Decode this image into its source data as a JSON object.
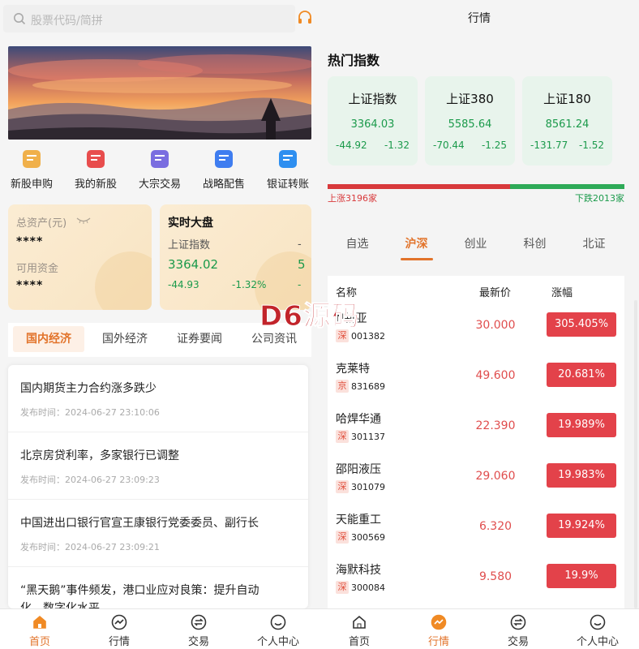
{
  "left": {
    "search": {
      "placeholder": "股票代码/简拼"
    },
    "quick": [
      {
        "label": "新股申购",
        "icon": "ipo-icon",
        "color": "#f0b04a"
      },
      {
        "label": "我的新股",
        "icon": "my-stock-icon",
        "color": "#e84d4d"
      },
      {
        "label": "大宗交易",
        "icon": "block-trade-icon",
        "color": "#7a6de0"
      },
      {
        "label": "战略配售",
        "icon": "placement-icon",
        "color": "#3f7df0"
      },
      {
        "label": "银证转账",
        "icon": "bank-transfer-icon",
        "color": "#2e8ff0"
      }
    ],
    "assets": {
      "total_label": "总资产(元)",
      "total_value": "****",
      "avail_label": "可用资金",
      "avail_value": "****"
    },
    "bigboard": {
      "title": "实时大盘",
      "name": "上证指数",
      "price": "3364.02",
      "chg": "-44.93",
      "pct": "-1.32%",
      "ghost_name": "-",
      "ghost_price": "5",
      "ghost_chg": "-"
    },
    "news_tabs": [
      "国内经济",
      "国外经济",
      "证券要闻",
      "公司资讯"
    ],
    "news": [
      {
        "title": "国内期货主力合约涨多跌少",
        "time": "发布时间：2024-06-27 23:10:06"
      },
      {
        "title": "北京房贷利率，多家银行已调整",
        "time": "发布时间：2024-06-27 23:09:23"
      },
      {
        "title": "中国进出口银行官宣王康银行党委委员、副行长",
        "time": "发布时间：2024-06-27 23:09:21"
      },
      {
        "title": "“黑天鹅”事件频发，港口业应对良策：提升自动",
        "time": "化、数字化水平"
      }
    ]
  },
  "right": {
    "title": "行情",
    "hot_title": "热门指数",
    "indices": [
      {
        "name": "上证指数",
        "price": "3364.03",
        "chg": "-44.92",
        "pct": "-1.32"
      },
      {
        "name": "上证380",
        "price": "5585.64",
        "chg": "-70.44",
        "pct": "-1.25"
      },
      {
        "name": "上证180",
        "price": "8561.24",
        "chg": "-131.77",
        "pct": "-1.52"
      }
    ],
    "up_label": "上涨3196家",
    "down_label": "下跌2013家",
    "up_ratio": 0.615,
    "market_tabs": [
      "自选",
      "沪深",
      "创业",
      "科创",
      "北证"
    ],
    "table_headers": {
      "name": "名称",
      "price": "最新价",
      "change": "涨幅"
    },
    "stocks": [
      {
        "name": "N新亚",
        "market": "深",
        "code": "001382",
        "price": "30.000",
        "change": "305.405%"
      },
      {
        "name": "克莱特",
        "market": "京",
        "code": "831689",
        "price": "49.600",
        "change": "20.681%"
      },
      {
        "name": "哈焊华通",
        "market": "深",
        "code": "301137",
        "price": "22.390",
        "change": "19.989%"
      },
      {
        "name": "邵阳液压",
        "market": "深",
        "code": "301079",
        "price": "29.060",
        "change": "19.983%"
      },
      {
        "name": "天能重工",
        "market": "深",
        "code": "300569",
        "price": "6.320",
        "change": "19.924%"
      },
      {
        "name": "海默科技",
        "market": "深",
        "code": "300084",
        "price": "9.580",
        "change": "19.9%"
      }
    ]
  },
  "tabbar": [
    "首页",
    "行情",
    "交易",
    "个人中心"
  ],
  "watermark": "D6源码"
}
